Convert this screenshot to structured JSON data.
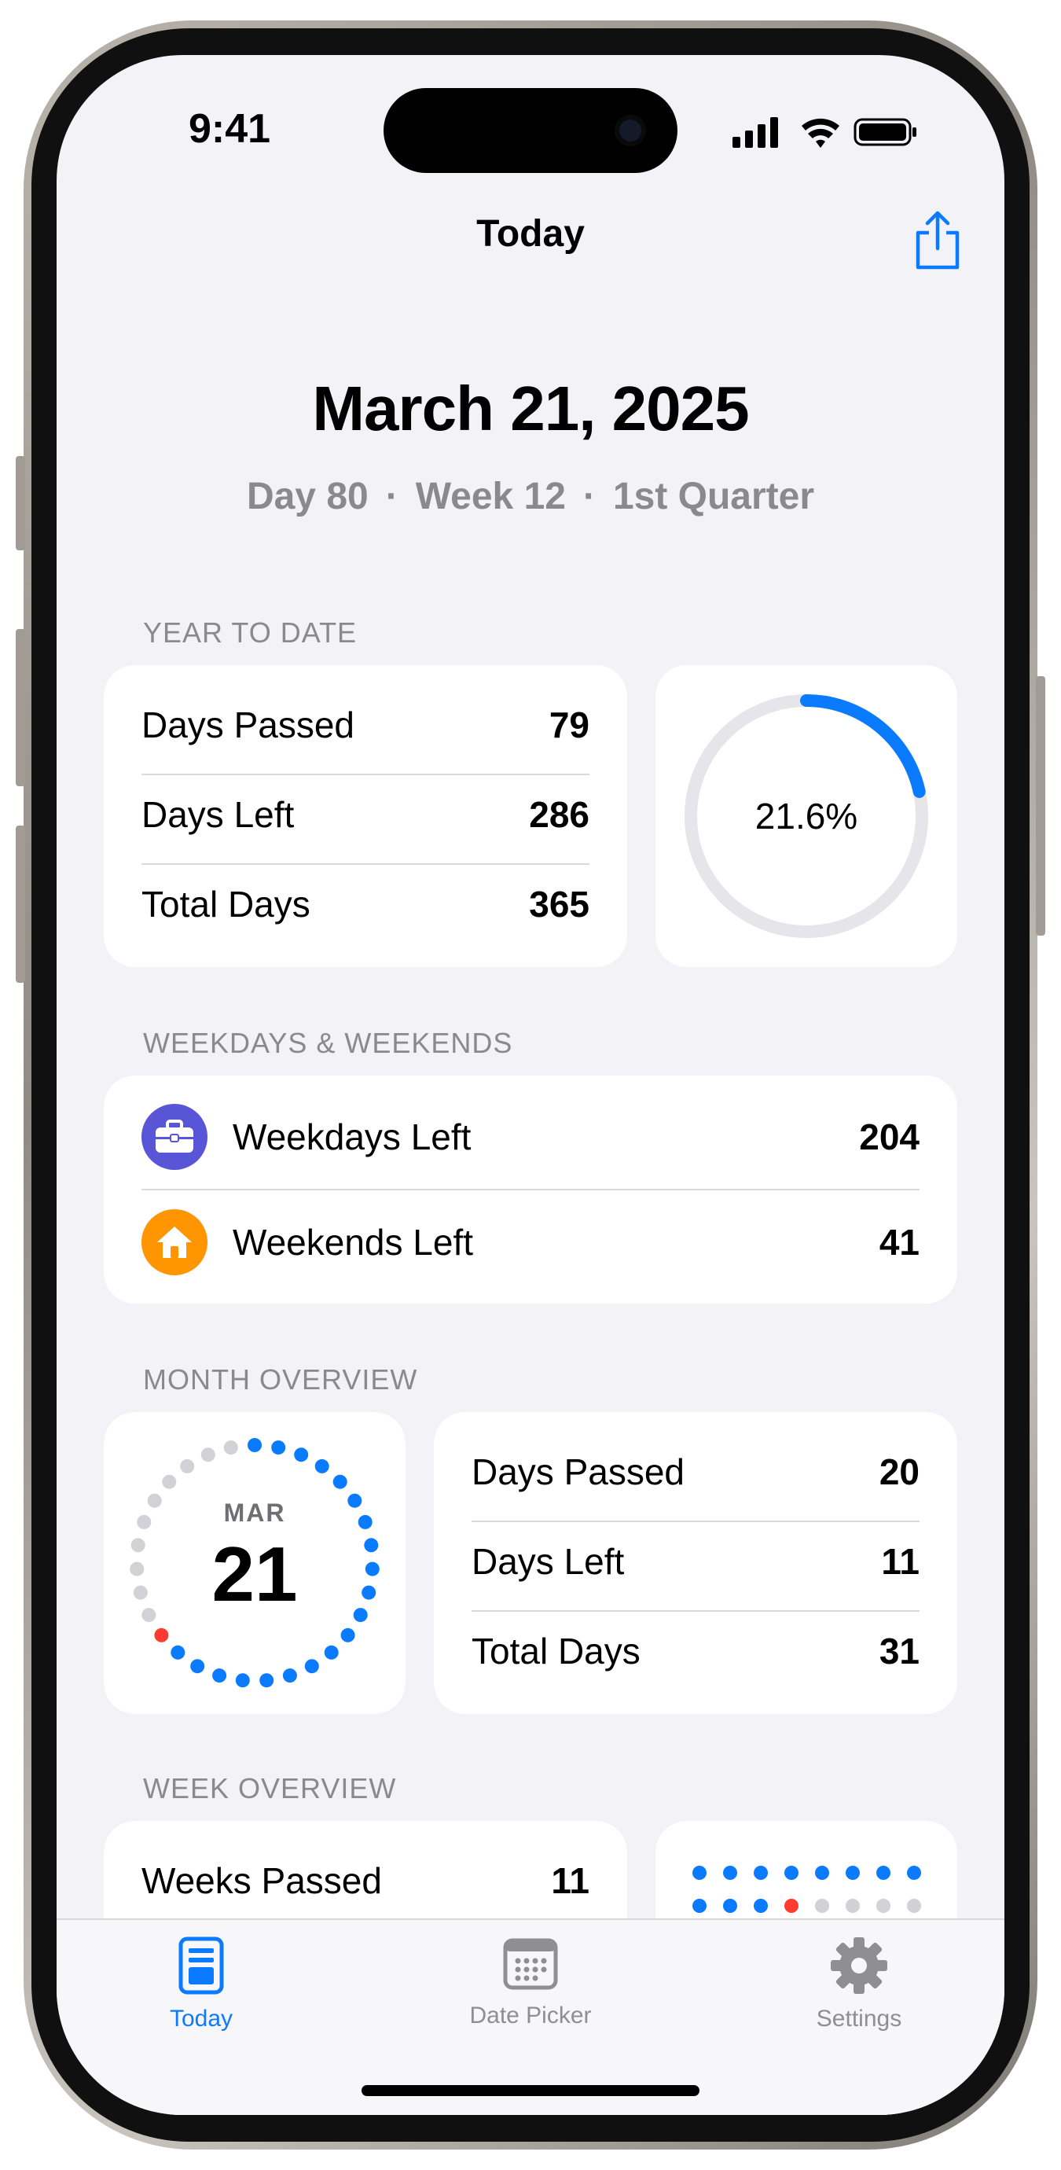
{
  "status_bar": {
    "time": "9:41"
  },
  "nav": {
    "title": "Today",
    "share_icon": "share-icon"
  },
  "header": {
    "date": "March 21, 2025",
    "day": "Day 80",
    "week": "Week 12",
    "quarter": "1st Quarter",
    "separator": "·"
  },
  "year_to_date": {
    "label": "YEAR TO DATE",
    "rows": [
      {
        "label": "Days Passed",
        "value": "79"
      },
      {
        "label": "Days Left",
        "value": "286"
      },
      {
        "label": "Total Days",
        "value": "365"
      }
    ],
    "percent_text": "21.6%",
    "progress": 0.216
  },
  "weekdays": {
    "label": "WEEKDAYS & WEEKENDS",
    "rows": [
      {
        "label": "Weekdays Left",
        "value": "204",
        "icon": "briefcase-icon",
        "color": "#5856d6"
      },
      {
        "label": "Weekends Left",
        "value": "41",
        "icon": "house-icon",
        "color": "#ff9500"
      }
    ]
  },
  "month": {
    "label": "MONTH OVERVIEW",
    "month_abbr": "MAR",
    "day": "21",
    "days_in_month": 31,
    "days_passed_count": 20,
    "rows": [
      {
        "label": "Days Passed",
        "value": "20"
      },
      {
        "label": "Days Left",
        "value": "11"
      },
      {
        "label": "Total Days",
        "value": "31"
      }
    ]
  },
  "week": {
    "label": "WEEK OVERVIEW",
    "rows": [
      {
        "label": "Weeks Passed",
        "value": "11"
      }
    ],
    "dot_rows": [
      [
        "blue",
        "blue",
        "blue",
        "blue",
        "blue",
        "blue",
        "blue",
        "blue"
      ],
      [
        "blue",
        "blue",
        "blue",
        "red",
        "gray",
        "gray",
        "gray",
        "gray"
      ]
    ]
  },
  "tabs": [
    {
      "label": "Today",
      "icon": "book-icon",
      "active": true
    },
    {
      "label": "Date Picker",
      "icon": "calendar-icon",
      "active": false
    },
    {
      "label": "Settings",
      "icon": "gear-icon",
      "active": false
    }
  ],
  "colors": {
    "accent": "#0a7aff",
    "ring_track": "#e5e5ea",
    "today_dot": "#ff3b30",
    "future_dot": "#d1d1d6",
    "tab_inactive": "#8e8e93"
  }
}
